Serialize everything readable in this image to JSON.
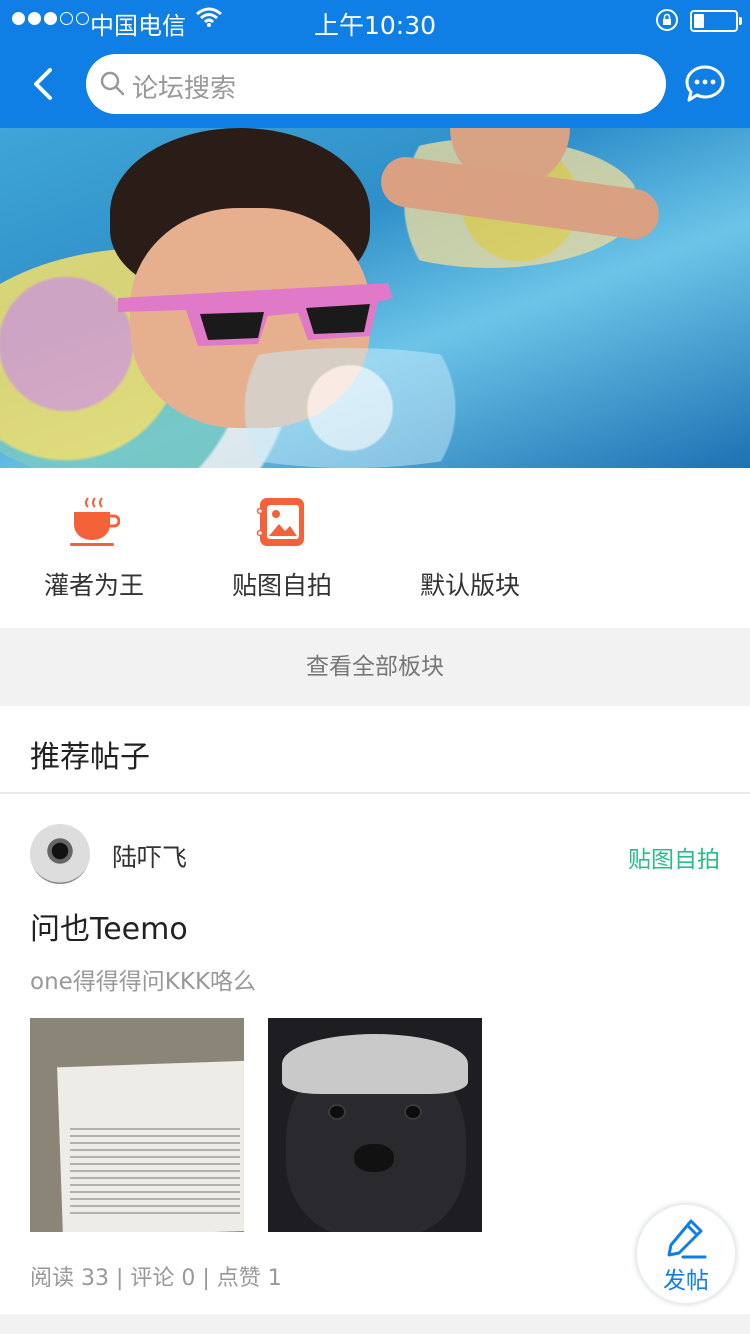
{
  "status_bar": {
    "carrier": "中国电信",
    "time": "上午10:30",
    "signal_dots_filled": 3,
    "signal_dots_total": 5,
    "battery_level": 0.2
  },
  "nav": {
    "back_icon": "chevron-left-icon",
    "search_placeholder": "论坛搜索",
    "chat_icon": "chat-bubble-icon"
  },
  "colors": {
    "primary": "#0f7fe6",
    "accent_orange": "#f4623a",
    "board_tag": "#25c08a"
  },
  "categories": [
    {
      "label": "灌者为王",
      "icon": "coffee-cup-icon"
    },
    {
      "label": "贴图自拍",
      "icon": "photo-album-icon"
    },
    {
      "label": "默认版块",
      "icon": ""
    }
  ],
  "view_all_label": "查看全部板块",
  "section_title": "推荐帖子",
  "post": {
    "author": "陆吓飞",
    "board": "贴图自拍",
    "title": "问也Teemo",
    "summary": "one得得得问KKK咯么",
    "stats": "阅读 33 | 评论 0 | 点赞 1"
  },
  "fab": {
    "label": "发帖",
    "icon": "pencil-icon"
  }
}
